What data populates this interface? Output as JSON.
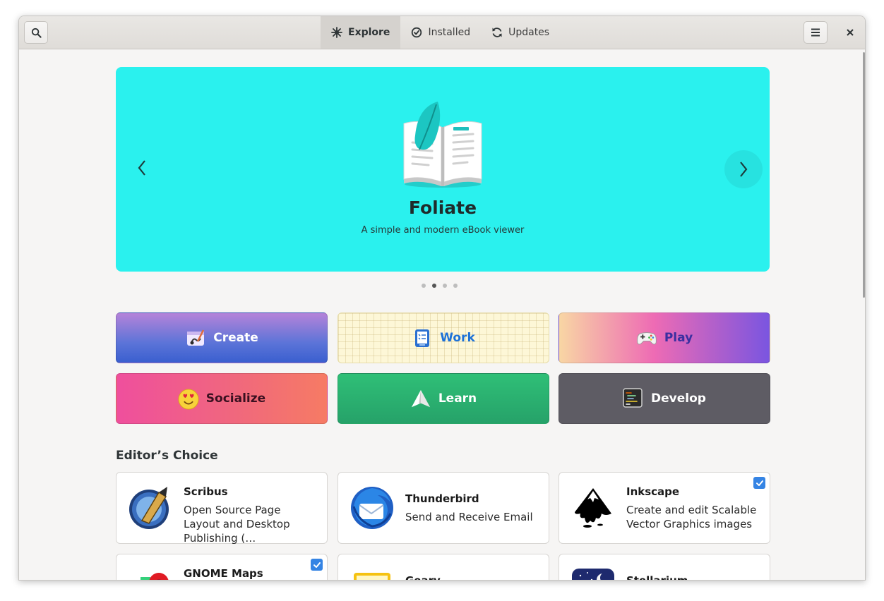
{
  "header": {
    "tabs": [
      {
        "label": "Explore",
        "icon": "explore-icon"
      },
      {
        "label": "Installed",
        "icon": "installed-icon"
      },
      {
        "label": "Updates",
        "icon": "updates-icon"
      }
    ],
    "active_tab": "Explore"
  },
  "banner": {
    "title": "Foliate",
    "subtitle": "A simple and modern eBook viewer",
    "color": "#2af1ee",
    "page_count": 4,
    "active_page": 2
  },
  "categories": [
    {
      "label": "Create",
      "icon": "create-icon"
    },
    {
      "label": "Work",
      "icon": "work-icon"
    },
    {
      "label": "Play",
      "icon": "gamepad-icon"
    },
    {
      "label": "Socialize",
      "icon": "emoji-icon"
    },
    {
      "label": "Learn",
      "icon": "paper-plane-icon"
    },
    {
      "label": "Develop",
      "icon": "terminal-icon"
    }
  ],
  "editors_choice": {
    "title": "Editor’s Choice",
    "apps": [
      {
        "name": "Scribus",
        "description": "Open Source Page Layout and Desktop Publishing (…",
        "installed": false
      },
      {
        "name": "Thunderbird",
        "description": "Send and Receive Email",
        "installed": false
      },
      {
        "name": "Inkscape",
        "description": "Create and edit Scalable Vector Graphics images",
        "installed": true
      },
      {
        "name": "GNOME Maps",
        "description": "",
        "installed": true
      },
      {
        "name": "Geary",
        "description": "",
        "installed": false
      },
      {
        "name": "Stellarium",
        "description": "",
        "installed": false
      }
    ]
  },
  "colors": {
    "accent": "#3584e4",
    "window_bg": "#f6f5f4"
  }
}
